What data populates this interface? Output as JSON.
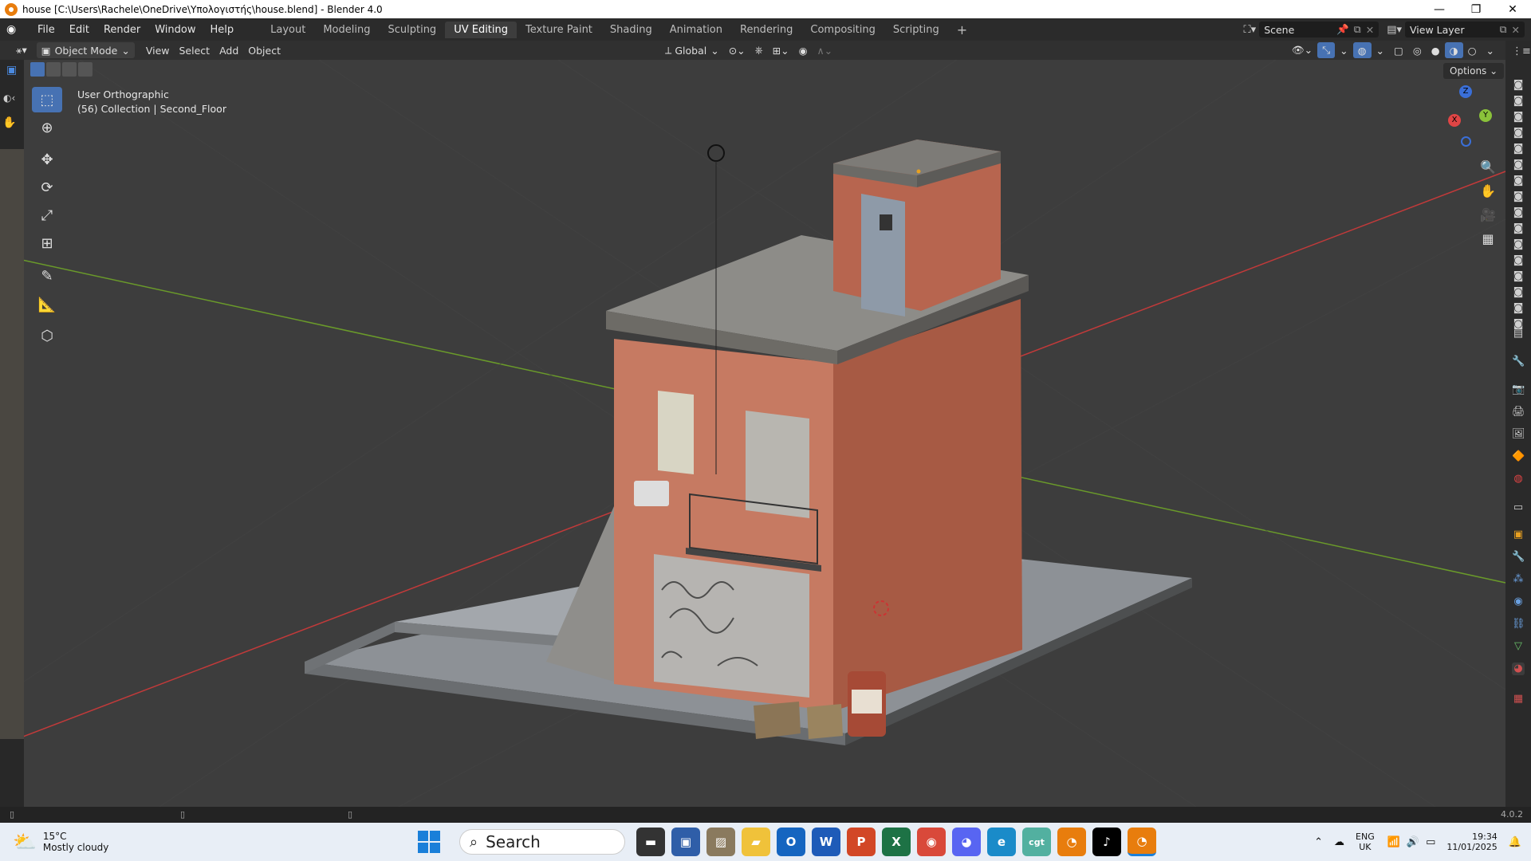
{
  "window": {
    "title": "house [C:\\Users\\Rachele\\OneDrive\\Υπολογιστής\\house.blend] - Blender 4.0",
    "min": "—",
    "max": "❐",
    "close": "✕"
  },
  "menu": [
    "File",
    "Edit",
    "Render",
    "Window",
    "Help"
  ],
  "workspaces": [
    "Layout",
    "Modeling",
    "Sculpting",
    "UV Editing",
    "Texture Paint",
    "Shading",
    "Animation",
    "Rendering",
    "Compositing",
    "Scripting"
  ],
  "active_workspace": "UV Editing",
  "scene": {
    "label": "Scene",
    "view_layer": "View Layer"
  },
  "header": {
    "mode": "Object Mode",
    "view": "View",
    "select": "Select",
    "add": "Add",
    "object": "Object",
    "orientation": "Global",
    "options": "Options"
  },
  "viewport": {
    "view_name": "User Orthographic",
    "collection": "(56) Collection | Second_Floor"
  },
  "gizmo": {
    "x": "X",
    "y": "Y",
    "z": "Z"
  },
  "statusbar": {
    "version": "4.0.2"
  },
  "taskbar": {
    "weather_temp": "15°C",
    "weather_text": "Mostly cloudy",
    "search": "Search",
    "lang_top": "ENG",
    "lang_bottom": "UK",
    "time": "19:34",
    "date": "11/01/2025"
  },
  "colors": {
    "accent": "#4772b3",
    "axis_x": "#c23a3a",
    "axis_y": "#6a9a2a",
    "blender_orange": "#e87d0d"
  }
}
